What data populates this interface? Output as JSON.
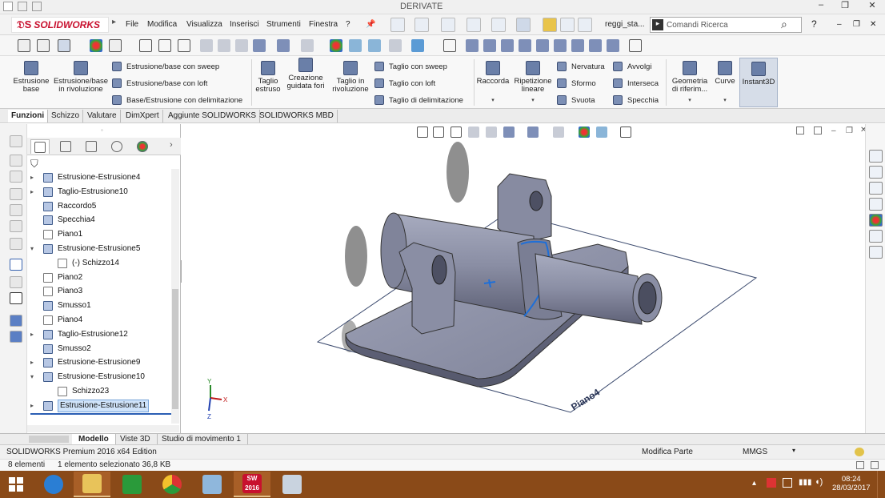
{
  "window": {
    "title": "DERIVATE",
    "controls": [
      "–",
      "❐",
      "✕"
    ]
  },
  "menubar": {
    "app_name": "SOLIDWORKS",
    "items": [
      "File",
      "Modifica",
      "Visualizza",
      "Inserisci",
      "Strumenti",
      "Finestra",
      "?"
    ],
    "document_name": "reggi_sta...",
    "search_placeholder": "Comandi Ricerca",
    "help_label": "?",
    "window_controls": [
      "–",
      "❐",
      "✕"
    ]
  },
  "ribbon": {
    "large_buttons": [
      {
        "label": "Estrusione base",
        "icon": "extrude-boss-icon"
      },
      {
        "label": "Estrusione/base in rivoluzione",
        "icon": "revolve-boss-icon"
      },
      {
        "label": "Taglio estruso",
        "icon": "extruded-cut-icon"
      },
      {
        "label": "Creazione guidata fori",
        "icon": "hole-wizard-icon"
      },
      {
        "label": "Taglio in rivoluzione",
        "icon": "revolved-cut-icon"
      },
      {
        "label": "Raccorda",
        "icon": "fillet-icon"
      },
      {
        "label": "Ripetizione lineare",
        "icon": "linear-pattern-icon"
      },
      {
        "label": "Geometria di riferim...",
        "icon": "reference-geometry-icon"
      },
      {
        "label": "Curve",
        "icon": "curves-icon"
      },
      {
        "label": "Instant3D",
        "icon": "instant3d-icon"
      }
    ],
    "boss_group": [
      "Estrusione/base con sweep",
      "Estrusione/base con loft",
      "Base/Estrusione con delimitazione"
    ],
    "cut_group": [
      "Taglio con sweep",
      "Taglio con loft",
      "Taglio di delimitazione"
    ],
    "features_group": [
      "Nervatura",
      "Sformo",
      "Svuota"
    ],
    "features_group2": [
      "Avvolgi",
      "Interseca",
      "Specchia"
    ]
  },
  "command_tabs": [
    "Funzioni",
    "Schizzo",
    "Valutare",
    "DimXpert",
    "Aggiunte SOLIDWORKS",
    "SOLIDWORKS MBD"
  ],
  "feature_tree": [
    {
      "label": "Estrusione-Estrusione4",
      "arrow": "▸",
      "type": "feature"
    },
    {
      "label": "Taglio-Estrusione10",
      "arrow": "▸",
      "type": "feature"
    },
    {
      "label": "Raccordo5",
      "arrow": "",
      "type": "feature"
    },
    {
      "label": "Specchia4",
      "arrow": "",
      "type": "feature"
    },
    {
      "label": "Piano1",
      "arrow": "",
      "type": "plane"
    },
    {
      "label": "Estrusione-Estrusione5",
      "arrow": "▾",
      "type": "feature"
    },
    {
      "label": "(-) Schizzo14",
      "arrow": "",
      "type": "sketch",
      "indent": true
    },
    {
      "label": "Piano2",
      "arrow": "",
      "type": "plane"
    },
    {
      "label": "Piano3",
      "arrow": "",
      "type": "plane"
    },
    {
      "label": "Smusso1",
      "arrow": "",
      "type": "feature"
    },
    {
      "label": "Piano4",
      "arrow": "",
      "type": "plane"
    },
    {
      "label": "Taglio-Estrusione12",
      "arrow": "▸",
      "type": "feature"
    },
    {
      "label": "Smusso2",
      "arrow": "",
      "type": "feature"
    },
    {
      "label": "Estrusione-Estrusione9",
      "arrow": "▸",
      "type": "feature"
    },
    {
      "label": "Estrusione-Estrusione10",
      "arrow": "▾",
      "type": "feature"
    },
    {
      "label": "Schizzo23",
      "arrow": "",
      "type": "sketch",
      "indent": true
    },
    {
      "label": "Estrusione-Estrusione11",
      "arrow": "▸",
      "type": "feature",
      "selected": true
    }
  ],
  "viewport": {
    "plane_label": "Piano4",
    "triad_labels": [
      "Y",
      "X",
      "Z"
    ]
  },
  "bottom_tabs": [
    "Modello",
    "Viste 3D",
    "Studio di movimento 1"
  ],
  "statusbar": {
    "edition": "SOLIDWORKS Premium 2016 x64 Edition",
    "mode": "Modifica Parte",
    "units": "MMGS"
  },
  "explorer_status": {
    "items": "8 elementi",
    "selection": "1 elemento selezionato  36,8 KB"
  },
  "taskbar": {
    "sw_label": "SW 2016",
    "time": "08:24",
    "date": "28/03/2017"
  },
  "colors": {
    "brand_red": "#c8102e",
    "model_gray": "#8b8fa6",
    "taskbar": "#8a4a18"
  }
}
